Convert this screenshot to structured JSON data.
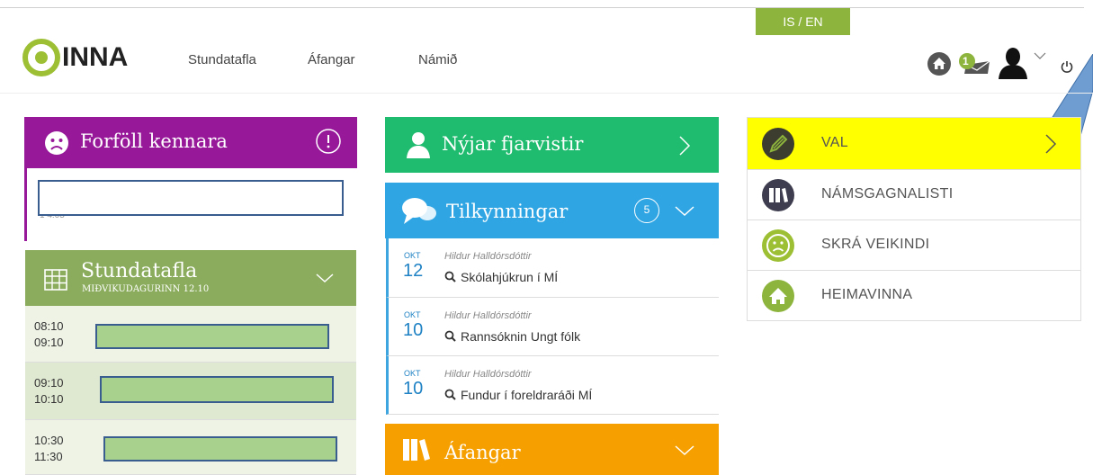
{
  "header": {
    "lang_toggle": "IS / EN",
    "logo_text": "INNA",
    "nav": [
      "Stundatafla",
      "Áfangar",
      "Námið"
    ],
    "notification_count": "1"
  },
  "forfoll": {
    "title": "Forföll kennara",
    "partial_text": "1 4:05"
  },
  "stundatafla": {
    "title": "Stundatafla",
    "subtitle": "MIÐVIKUDAGURINN 12.10",
    "rows": [
      {
        "start": "08:10",
        "end": "09:10"
      },
      {
        "start": "09:10",
        "end": "10:10"
      },
      {
        "start": "10:30",
        "end": "11:30"
      }
    ]
  },
  "fjarvistir": {
    "title": "Nýjar fjarvistir"
  },
  "tilkynningar": {
    "title": "Tilkynningar",
    "count": "5",
    "items": [
      {
        "month": "OKT",
        "day": "12",
        "author": "Hildur Halldórsdóttir",
        "title": "Skólahjúkrun í MÍ"
      },
      {
        "month": "OKT",
        "day": "10",
        "author": "Hildur Halldórsdóttir",
        "title": "Rannsóknin Ungt fólk"
      },
      {
        "month": "OKT",
        "day": "10",
        "author": "Hildur Halldórsdóttir",
        "title": "Fundur í foreldraráði MÍ"
      }
    ]
  },
  "afangar": {
    "title": "Áfangar"
  },
  "quicklinks": [
    {
      "label": "VAL",
      "icon": "pencil-icon",
      "color": "#8db43c",
      "highlight": "#ffff00"
    },
    {
      "label": "NÁMSGAGNALISTI",
      "icon": "books-icon",
      "color": "#3d3d4f"
    },
    {
      "label": "SKRÁ VEIKINDI",
      "icon": "sad-face-icon",
      "color": "#9cbf34"
    },
    {
      "label": "HEIMAVINNA",
      "icon": "home-icon",
      "color": "#8db43c"
    }
  ],
  "colors": {
    "purple": "#97199a",
    "green_dark": "#8aac5c",
    "green_teal": "#1fbb6e",
    "blue": "#30a5e3",
    "orange": "#f59f00",
    "lime": "#9cbf34",
    "highlight": "#ffff00"
  }
}
